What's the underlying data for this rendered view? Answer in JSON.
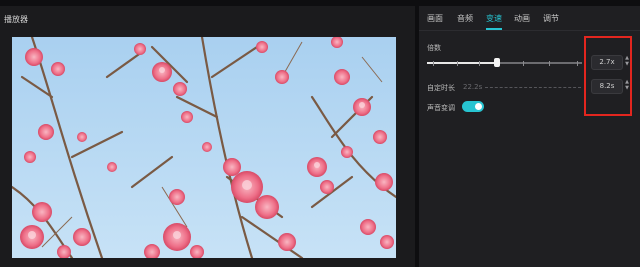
{
  "player": {
    "title": "播放器"
  },
  "tabs": [
    {
      "label": "画面",
      "active": false
    },
    {
      "label": "音频",
      "active": false
    },
    {
      "label": "变速",
      "active": true
    },
    {
      "label": "动画",
      "active": false
    },
    {
      "label": "调节",
      "active": false
    }
  ],
  "speed": {
    "multiplier_label": "倍数",
    "multiplier_value": "2.7x",
    "custom_duration_label": "自定时长",
    "original_duration": "22.2s",
    "duration_value": "8.2s",
    "pitch_label": "声音变调",
    "pitch_enabled": true
  },
  "colors": {
    "accent": "#27c4d1",
    "highlight": "#e3261f"
  },
  "icons": {
    "spinner_up": "▲",
    "spinner_down": "▼"
  }
}
